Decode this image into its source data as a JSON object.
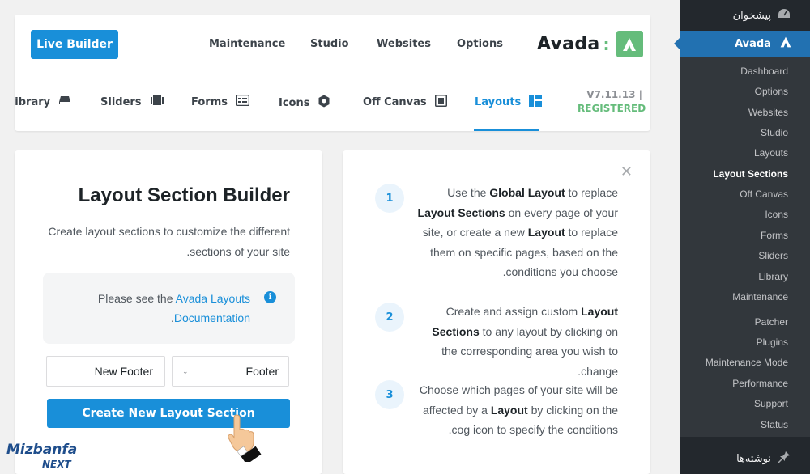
{
  "header": {
    "live_builder": "Live Builder",
    "nav": [
      "Maintenance",
      "Studio",
      "Websites",
      "Options"
    ],
    "brand": "Avada",
    "brand_colon": ":"
  },
  "subnav": {
    "items": [
      {
        "label": "Library",
        "icon": "library-icon"
      },
      {
        "label": "Sliders",
        "icon": "sliders-icon"
      },
      {
        "label": "Forms",
        "icon": "forms-icon"
      },
      {
        "label": "Icons",
        "icon": "icons-icon"
      },
      {
        "label": "Off Canvas",
        "icon": "off-canvas-icon"
      },
      {
        "label": "Layouts",
        "icon": "layouts-icon",
        "active": true
      }
    ],
    "version": "V7.11.13 |",
    "registered": "REGISTERED"
  },
  "builder": {
    "title": "Layout Section Builder",
    "description": "Create layout sections to customize the different sections of your site.",
    "doc_prefix": "Please see the",
    "doc_link": "Avada Layouts Documentation",
    "doc_suffix": ".",
    "name_value": "New Footer",
    "type_value": "Footer",
    "create_button": "Create New Layout Section"
  },
  "steps": [
    {
      "num": "1"
    },
    {
      "num": "2"
    },
    {
      "num": "3"
    }
  ],
  "sidebar": {
    "dashboard": "پیشخوان",
    "avada": "Avada",
    "items": [
      "Dashboard",
      "Options",
      "Websites",
      "Studio",
      "Layouts",
      "Layout Sections",
      "Off Canvas",
      "Icons",
      "Forms",
      "Sliders",
      "Library",
      "Maintenance",
      "Patcher",
      "Plugins",
      "Maintenance Mode",
      "Performance",
      "Support",
      "Status"
    ],
    "current": "Layout Sections",
    "posts": "نوشته‌ها"
  },
  "watermark": {
    "line1": "Mizbanfa",
    "line2": "NEXT"
  },
  "colors": {
    "accent": "#198fd9",
    "brand_green": "#65bc7b",
    "sidebar_bg": "#23282d",
    "sidebar_active": "#2271b1"
  }
}
